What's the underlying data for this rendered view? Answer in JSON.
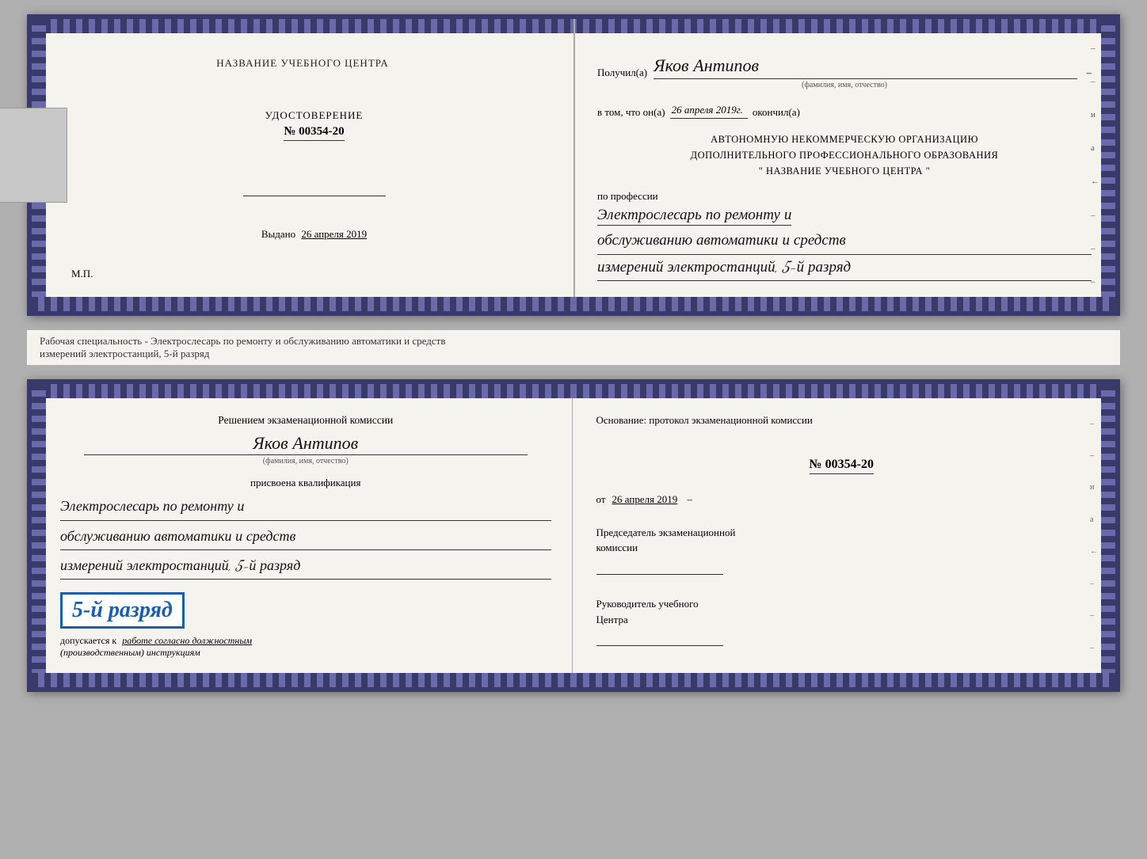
{
  "top_doc": {
    "left": {
      "title": "НАЗВАНИЕ УЧЕБНОГО ЦЕНТРА",
      "cert_label": "УДОСТОВЕРЕНИЕ",
      "cert_number": "№ 00354-20",
      "issued_label": "Выдано",
      "issued_date": "26 апреля 2019",
      "mp": "М.П."
    },
    "right": {
      "recipient_label": "Получил(а)",
      "recipient_name": "Яков Антипов",
      "fio_hint": "(фамилия, имя, отчество)",
      "date_label": "в том, что он(а)",
      "date_value": "26 апреля 2019г.",
      "completed_label": "окончил(а)",
      "org_line1": "АВТОНОМНУЮ НЕКОММЕРЧЕСКУЮ ОРГАНИЗАЦИЮ",
      "org_line2": "ДОПОЛНИТЕЛЬНОГО ПРОФЕССИОНАЛЬНОГО ОБРАЗОВАНИЯ",
      "org_name": "\"  НАЗВАНИЕ УЧЕБНОГО ЦЕНТРА  \"",
      "profession_label": "по профессии",
      "profession_line1": "Электрослесарь по ремонту и",
      "profession_line2": "обслуживанию автоматики и средств",
      "profession_line3": "измерений электростанций, 5-й разряд",
      "side_labels": [
        "–",
        "–",
        "и",
        "а",
        "←",
        "–",
        "–",
        "–"
      ]
    }
  },
  "info_text": {
    "line1": "Рабочая специальность - Электрослесарь по ремонту и обслуживанию автоматики и средств",
    "line2": "измерений электростанций, 5-й разряд"
  },
  "bottom_doc": {
    "left": {
      "decision_title": "Решением  экзаменационной  комиссии",
      "person_name": "Яков Антипов",
      "fio_hint": "(фамилия, имя, отчество)",
      "qual_label": "присвоена квалификация",
      "qual_line1": "Электрослесарь по ремонту и",
      "qual_line2": "обслуживанию автоматики и средств",
      "qual_line3": "измерений электростанций, 5-й разряд",
      "rank_badge": "5-й разряд",
      "допускается_label": "допускается к",
      "допускается_text": "работе согласно должностным",
      "инструкциям": "(производственным) инструкциям"
    },
    "right": {
      "osnov_label": "Основание:  протокол  экзаменационной  комиссии",
      "protocol_number": "№  00354-20",
      "from_label": "от",
      "from_date": "26 апреля 2019",
      "chairman_title": "Председатель экзаменационной",
      "chairman_label": "комиссии",
      "руководитель_title": "Руководитель учебного",
      "руководитель_label": "Центра",
      "side_labels": [
        "–",
        "–",
        "и",
        "а",
        "←",
        "–",
        "–",
        "–"
      ]
    }
  }
}
